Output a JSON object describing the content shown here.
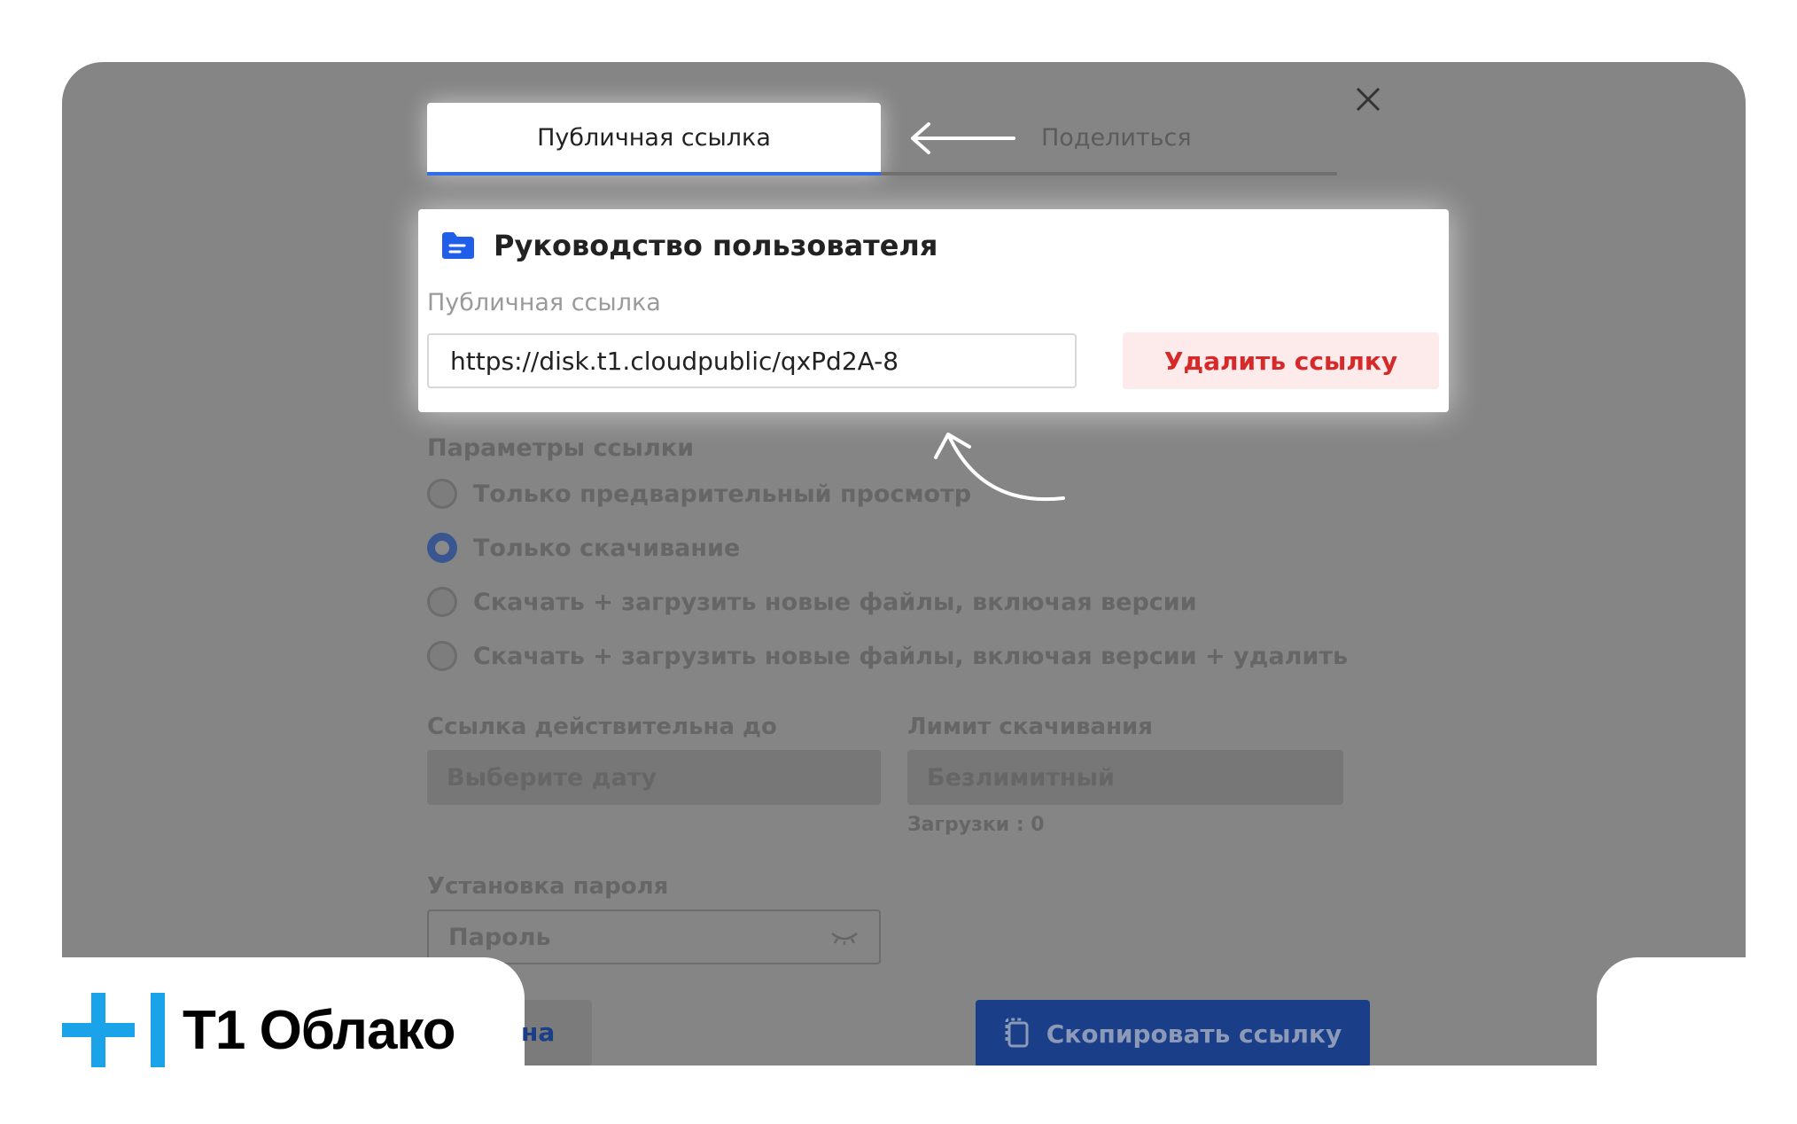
{
  "tabs": {
    "active_label": "Публичная ссылка",
    "share_label": "Поделиться"
  },
  "card": {
    "title": "Руководство пользователя",
    "link_label": "Публичная ссылка",
    "link_value": "https://disk.t1.cloudpublic/qxPd2A-8",
    "delete_label": "Удалить ссылку"
  },
  "params": {
    "title": "Параметры ссылки",
    "options": [
      {
        "label": "Только предварительный просмотр",
        "selected": false
      },
      {
        "label": "Только скачивание",
        "selected": true
      },
      {
        "label": "Скачать + загрузить новые файлы, включая версии",
        "selected": false
      },
      {
        "label": "Скачать + загрузить новые файлы, включая версии + удалить",
        "selected": false
      }
    ]
  },
  "expiry": {
    "label": "Ссылка действительна до",
    "placeholder": "Выберите дату"
  },
  "limit": {
    "label": "Лимит скачивания",
    "value": "Безлимитный",
    "downloads": "Загрузки : 0"
  },
  "password": {
    "label": "Установка пароля",
    "placeholder": "Пароль"
  },
  "footer": {
    "cancel_fragment": "на",
    "copy_label": "Скопировать ссылку"
  },
  "brand": {
    "name": "Т1 Облако",
    "accent": "#1aa3e8"
  },
  "colors": {
    "accent": "#2f6fe8",
    "danger": "#d62a2a",
    "danger_bg": "#fdeaea",
    "overlay": "#858585"
  }
}
